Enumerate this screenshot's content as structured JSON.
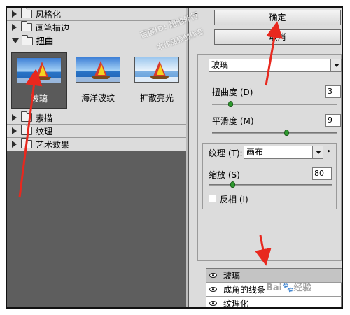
{
  "left_panel": {
    "categories_top": [
      {
        "label": "风格化",
        "expanded": false
      },
      {
        "label": "画笔描边",
        "expanded": false
      },
      {
        "label": "扭曲",
        "expanded": true
      }
    ],
    "thumbnails": [
      {
        "label": "玻璃",
        "selected": true
      },
      {
        "label": "海洋波纹",
        "selected": false
      },
      {
        "label": "扩散亮光",
        "selected": false
      }
    ],
    "categories_bottom": [
      {
        "label": "素描"
      },
      {
        "label": "纹理"
      },
      {
        "label": "艺术效果"
      }
    ]
  },
  "right_panel": {
    "collapse_glyph": "⌃",
    "ok_label": "确定",
    "cancel_label": "取消",
    "filter_select": "玻璃",
    "params": {
      "distortion_label": "扭曲度 (D)",
      "distortion_value": "3",
      "distortion_fraction": 0.15,
      "smoothness_label": "平滑度 (M)",
      "smoothness_value": "9",
      "smoothness_fraction": 0.6,
      "texture_label": "纹理 (T):",
      "texture_value": "画布",
      "scaling_label": "缩放 (S)",
      "scaling_value": "80",
      "scaling_fraction": 0.2,
      "invert_label": "反相 (I)",
      "invert_checked": false
    },
    "layers": [
      {
        "label": "玻璃",
        "active": true
      },
      {
        "label": "成角的线条",
        "active": false
      },
      {
        "label": "纹理化",
        "active": false
      }
    ]
  },
  "watermarks": {
    "main": "百度ID: 超他外行",
    "sub": "本作品原创作者",
    "bottom": "Bai🐾经验"
  },
  "colors": {
    "arrow": "#e8281e",
    "gallery_bg": "#5e5e5e",
    "panel_bg": "#dcdcdc",
    "slider_knob": "#2f9a2f"
  }
}
